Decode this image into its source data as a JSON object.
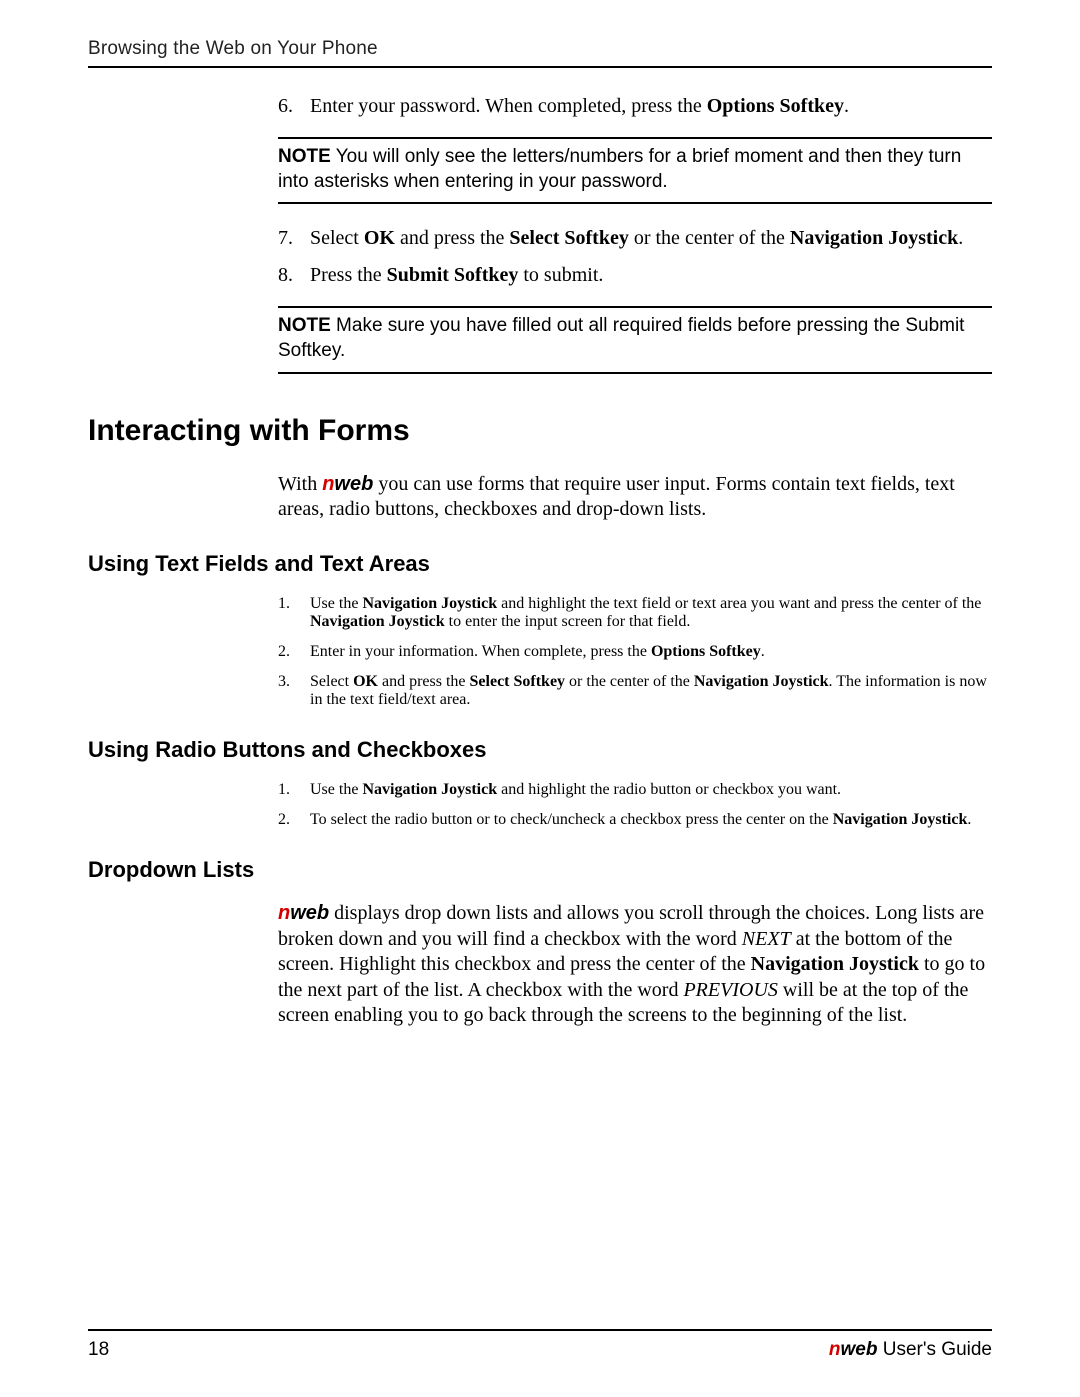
{
  "header": "Browsing the Web on Your Phone",
  "steps_a": {
    "6": {
      "num": "6.",
      "pre": "Enter your password. When completed, press the ",
      "bold1": "Options Softkey",
      "post": "."
    },
    "note1": {
      "label": "NOTE",
      "text": "  You will only see the letters/numbers for a brief moment and then they turn into asterisks when entering in your password."
    },
    "7": {
      "num": "7.",
      "t1": "Select ",
      "b1": "OK",
      "t2": " and press the ",
      "b2": "Select Softkey",
      "t3": " or the center of the ",
      "b3": "Navigation Joystick",
      "t4": "."
    },
    "8": {
      "num": "8.",
      "t1": "Press the ",
      "b1": "Submit Softkey",
      "t2": " to submit."
    },
    "note2": {
      "label": "NOTE",
      "text": "  Make sure you have filled out all required fields before pressing the Submit Softkey."
    }
  },
  "section1": {
    "title": "Interacting with Forms",
    "para": {
      "t1": "With ",
      "brand_n": "n",
      "brand_web": "web",
      "t2": " you can use forms that require user input. Forms contain text fields, text areas, radio buttons, checkboxes and drop-down lists."
    }
  },
  "sub1": {
    "title": "Using Text Fields and Text Areas",
    "li1": {
      "num": "1.",
      "t1": "Use the ",
      "b1": "Navigation Joystick",
      "t2": " and highlight the text field or text area you want and press the center of the ",
      "b2": "Navigation Joystick",
      "t3": " to enter the input screen for that field."
    },
    "li2": {
      "num": "2.",
      "t1": "Enter in your information. When complete, press the ",
      "b1": "Options Softkey",
      "t2": "."
    },
    "li3": {
      "num": "3.",
      "t1": "Select ",
      "b1": "OK",
      "t2": " and press the ",
      "b2": "Select Softkey",
      "t3": " or the center of the ",
      "b3": "Navigation Joystick",
      "t4": ". The information is now in the text field/text area."
    }
  },
  "sub2": {
    "title": "Using Radio Buttons and Checkboxes",
    "li1": {
      "num": "1.",
      "t1": "Use the ",
      "b1": "Navigation Joystick",
      "t2": " and highlight the radio button or checkbox you want."
    },
    "li2": {
      "num": "2.",
      "t1": "To select the radio button or to check/uncheck a checkbox press the center on the ",
      "b1": "Navigation Joystick",
      "t2": "."
    }
  },
  "sub3": {
    "title": "Dropdown Lists",
    "para": {
      "brand_n": "n",
      "brand_web": "web",
      "t1": " displays drop down lists and allows you scroll through the choices. Long lists are broken down and you will find a checkbox with the word ",
      "i1": "NEXT",
      "t2": " at the bottom of the screen. Highlight this checkbox and press the center of the ",
      "b1": "Navigation Joystick",
      "t3": " to go to the next part of the list. A checkbox with the word ",
      "i2": "PREVIOUS",
      "t4": " will be at the top of the screen enabling you to go back through the screens to the beginning of the list."
    }
  },
  "footer": {
    "page": "18",
    "brand_n": "n",
    "brand_web": "web",
    "text": " User's Guide"
  }
}
